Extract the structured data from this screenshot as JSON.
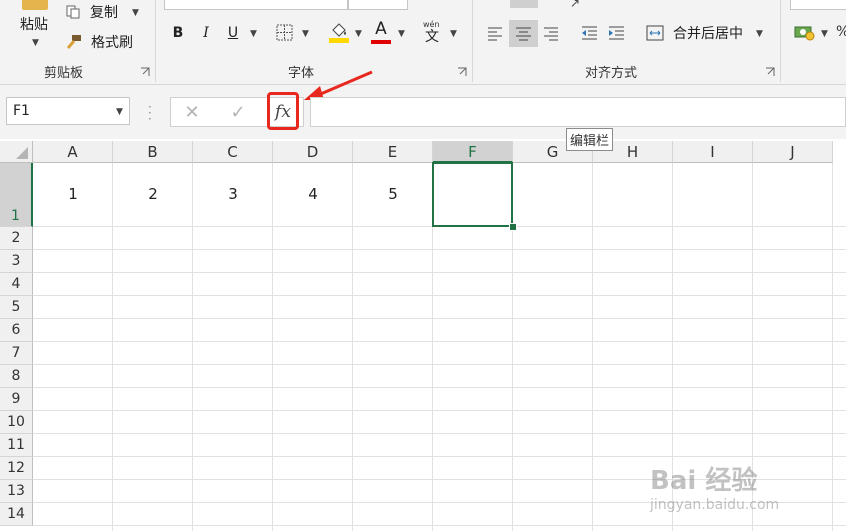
{
  "clipboard": {
    "paste_label": "粘贴",
    "copy_label": "复制",
    "format_painter_label": "格式刷",
    "group_label": "剪贴板"
  },
  "font": {
    "bold": "B",
    "italic": "I",
    "underline": "U",
    "font_color_glyph": "A",
    "phonetic_top": "wén",
    "phonetic_glyph": "文",
    "group_label": "字体"
  },
  "alignment": {
    "merge_center_label": "合并后居中",
    "group_label": "对齐方式"
  },
  "formula_bar": {
    "name_box": "F1",
    "cancel_glyph": "✕",
    "enter_glyph": "✓",
    "fx_label": "fx",
    "value": "",
    "tooltip": "编辑栏"
  },
  "grid": {
    "columns": [
      "A",
      "B",
      "C",
      "D",
      "E",
      "F",
      "G",
      "H",
      "I",
      "J"
    ],
    "rows": [
      "1",
      "2",
      "3",
      "4",
      "5",
      "6",
      "7",
      "8",
      "9",
      "10",
      "11",
      "12",
      "13",
      "14"
    ],
    "row1_values": {
      "A": "1",
      "B": "2",
      "C": "3",
      "D": "4",
      "E": "5"
    },
    "active_cell": "F1"
  },
  "colors": {
    "accent_green": "#217346",
    "annotation_red": "#e8281e",
    "font_color_red": "#e00000",
    "fill_yellow": "#ffd800"
  },
  "watermark": {
    "text": "Bai 经验",
    "url": "jingyan.baidu.com"
  }
}
